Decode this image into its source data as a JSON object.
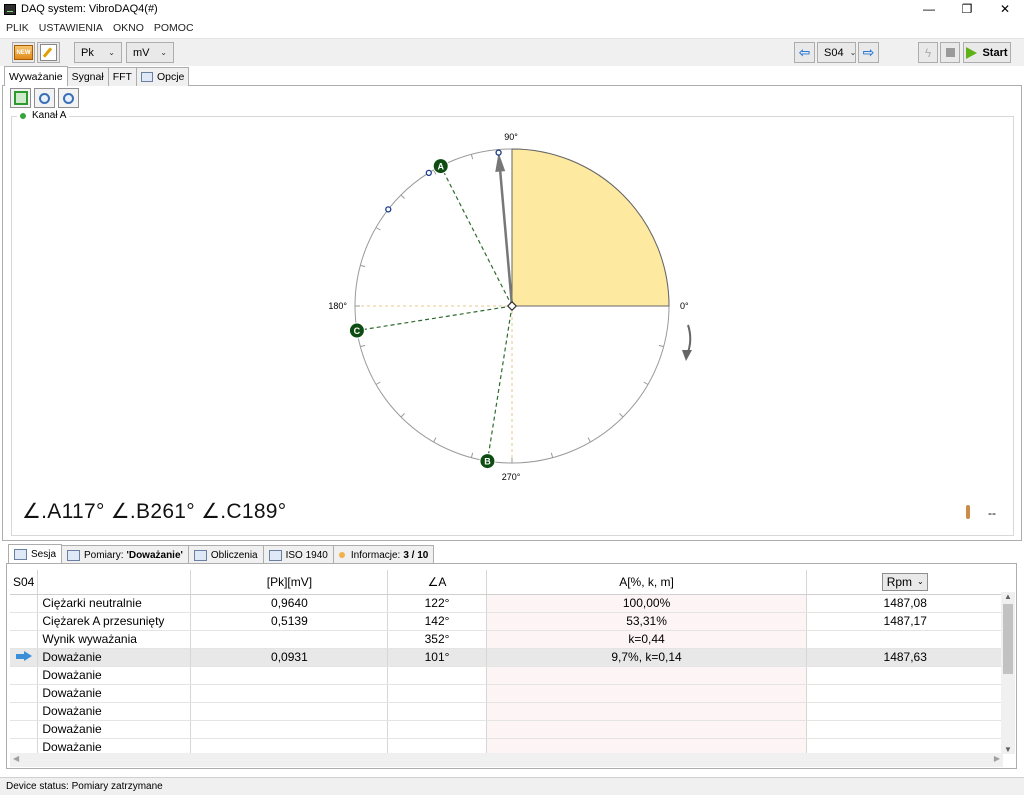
{
  "window": {
    "title": "DAQ system:  VibroDAQ4(#)",
    "minimize": "—",
    "restore": "❐",
    "close": "✕"
  },
  "menu": [
    "PLIK",
    "USTAWIENIA",
    "OKNO",
    "POMOC"
  ],
  "toolbar": {
    "new_label": "NEW",
    "pk_combo": "Pk",
    "mv_combo": "mV",
    "session_combo": "S04",
    "start_label": "Start"
  },
  "top_tabs": [
    "Wyważanie",
    "Sygnał",
    "FFT",
    "Opcje"
  ],
  "channel": {
    "label": "Kanał A"
  },
  "polar": {
    "label_0": "0°",
    "label_90": "90°",
    "label_180": "180°",
    "label_270": "270°",
    "sector_from_deg": 0,
    "sector_to_deg": 90,
    "vector_deg": 95,
    "markers": [
      {
        "label": "A",
        "angle_deg": 117
      },
      {
        "label": "B",
        "angle_deg": 261
      },
      {
        "label": "C",
        "angle_deg": 189
      }
    ],
    "small_points_deg": [
      122,
      142
    ],
    "colors": {
      "sector": "#fde9a0",
      "marker": "#0d4d12",
      "dash": "#2f6b2f"
    }
  },
  "angles_text": "∠.A117° ∠.B261° ∠.C189°",
  "temperature": "--",
  "bottom_tabs": [
    {
      "label": "Sesja"
    },
    {
      "label": "Pomiary: ",
      "bold": "'Doważanie'"
    },
    {
      "label": "Obliczenia"
    },
    {
      "label": "ISO 1940"
    },
    {
      "label": "Informacje:",
      "bold": "3 / 10"
    }
  ],
  "table": {
    "header": {
      "session": "S04",
      "pk": "[Pk][mV]",
      "angle": "∠A",
      "a": "A[%, k, m]",
      "rpm": "Rpm"
    },
    "rows": [
      {
        "name": "Ciężarki neutralnie",
        "pk": "0,9640",
        "angle": "122°",
        "a": "100,00%",
        "rpm": "1487,08"
      },
      {
        "name": "Ciężarek A przesunięty",
        "pk": "0,5139",
        "angle": "142°",
        "a": "53,31%",
        "rpm": "1487,17"
      },
      {
        "name": "Wynik wyważania",
        "pk": "",
        "angle": "352°",
        "a": "k=0,44",
        "rpm": ""
      },
      {
        "name": "Doważanie",
        "pk": "0,0931",
        "angle": "101°",
        "a": "9,7%, k=0,14",
        "rpm": "1487,63"
      },
      {
        "name": "Doważanie",
        "pk": "",
        "angle": "",
        "a": "",
        "rpm": ""
      },
      {
        "name": "Doważanie",
        "pk": "",
        "angle": "",
        "a": "",
        "rpm": ""
      },
      {
        "name": "Doważanie",
        "pk": "",
        "angle": "",
        "a": "",
        "rpm": ""
      },
      {
        "name": "Doważanie",
        "pk": "",
        "angle": "",
        "a": "",
        "rpm": ""
      },
      {
        "name": "Doważanie",
        "pk": "",
        "angle": "",
        "a": "",
        "rpm": ""
      }
    ]
  },
  "status": "Device status: Pomiary zatrzymane"
}
